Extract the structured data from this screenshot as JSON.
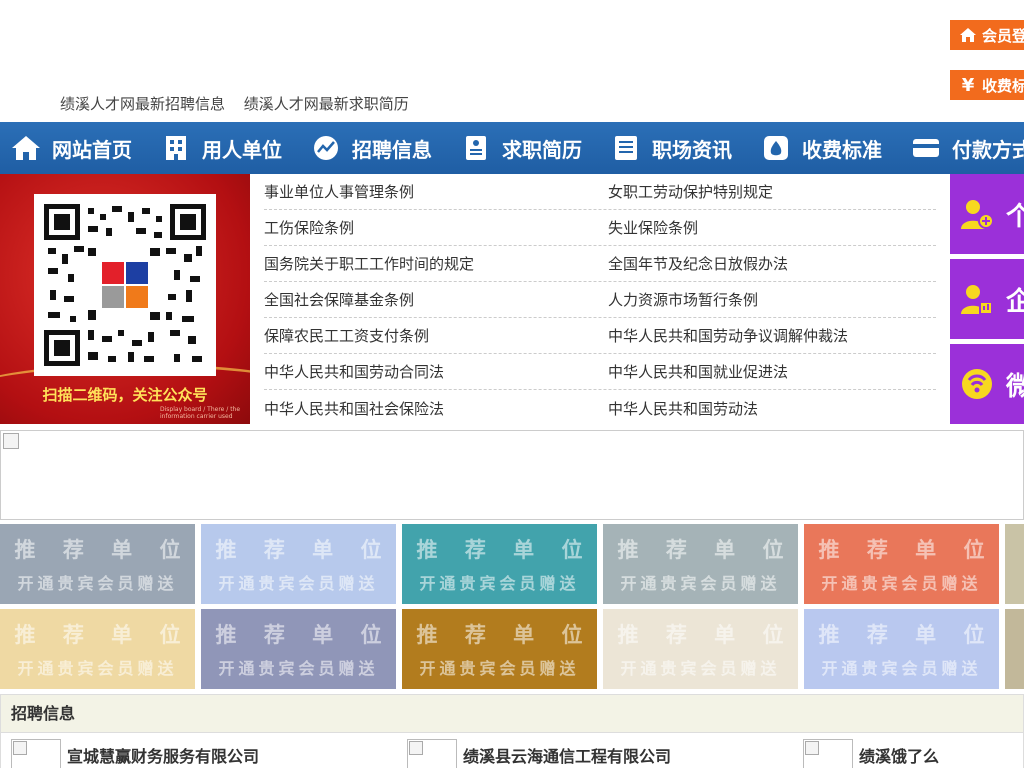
{
  "header": {
    "login_label": "会员登",
    "fee_label": "收费标",
    "links": [
      "绩溪人才网最新招聘信息",
      "绩溪人才网最新求职简历"
    ]
  },
  "nav": [
    {
      "label": "网站首页",
      "icon": "home-icon"
    },
    {
      "label": "用人单位",
      "icon": "building-icon"
    },
    {
      "label": "招聘信息",
      "icon": "chart-icon"
    },
    {
      "label": "求职简历",
      "icon": "resume-icon"
    },
    {
      "label": "职场资讯",
      "icon": "news-icon"
    },
    {
      "label": "收费标准",
      "icon": "money-bag-icon"
    },
    {
      "label": "付款方式",
      "icon": "card-icon"
    }
  ],
  "banner": {
    "caption": "扫描二维码，关注公众号",
    "tiny_text": "Display board / There / the information carrier used"
  },
  "laws": [
    [
      "事业单位人事管理条例",
      "女职工劳动保护特别规定"
    ],
    [
      "工伤保险条例",
      "失业保险条例"
    ],
    [
      "国务院关于职工工作时间的规定",
      "全国年节及纪念日放假办法"
    ],
    [
      "全国社会保障基金条例",
      "人力资源市场暂行条例"
    ],
    [
      "保障农民工工资支付条例",
      "中华人民共和国劳动争议调解仲裁法"
    ],
    [
      "中华人民共和国劳动合同法",
      "中华人民共和国就业促进法"
    ],
    [
      "中华人民共和国社会保险法",
      "中华人民共和国劳动法"
    ]
  ],
  "side_buttons": [
    {
      "label": "个",
      "icon": "person-add-icon"
    },
    {
      "label": "企",
      "icon": "company-user-icon"
    },
    {
      "label": "微",
      "icon": "wechat-icon"
    }
  ],
  "tiles": {
    "title": "推 荐 单 位",
    "subtitle": "开通贵宾会员赠送",
    "colors_row1": [
      "#9aa6b4",
      "#b7c9ec",
      "#42a3ac",
      "#a5b3b7",
      "#e9775a",
      "#c9c3a6"
    ],
    "colors_row2": [
      "#efd9a3",
      "#9096b8",
      "#b27c1e",
      "#ece5d6",
      "#b9c8ef",
      "#c2b89a"
    ]
  },
  "recruit": {
    "title": "招聘信息",
    "companies": [
      "宣城慧赢财务服务有限公司",
      "绩溪县云海通信工程有限公司",
      "绩溪饿了么"
    ]
  },
  "colors": {
    "nav_blue": "#2366ad",
    "orange": "#f26b1d",
    "purple": "#9b30d9",
    "banner_red": "#c8161b"
  }
}
